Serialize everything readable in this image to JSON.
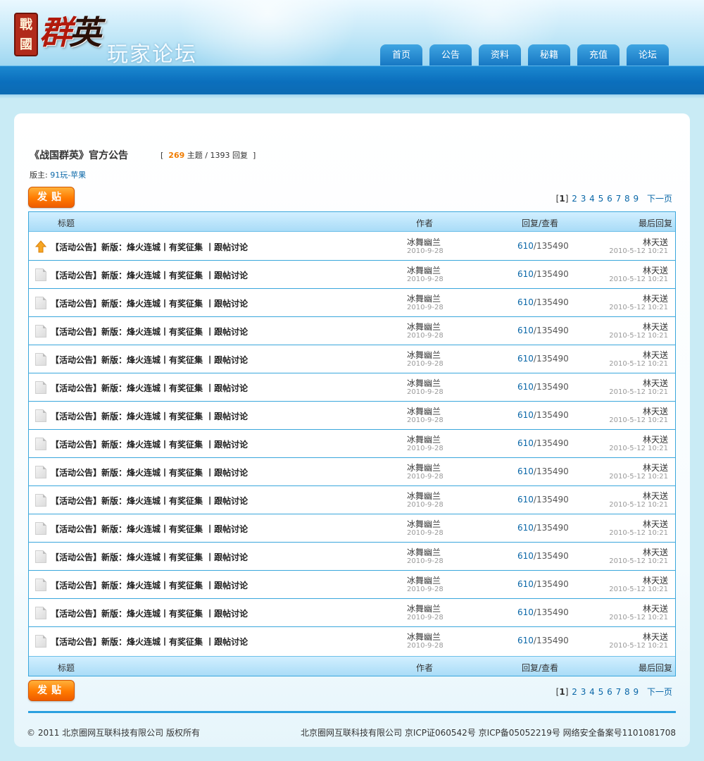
{
  "header": {
    "logo_seal": "戰國",
    "logo_main_1": "群",
    "logo_main_2": "英",
    "logo_sub": "玩家论坛",
    "nav": [
      "首页",
      "公告",
      "资料",
      "秘籍",
      "充值",
      "论坛"
    ]
  },
  "forum": {
    "title": "《战国群英》官方公告",
    "stats_open": "[",
    "topics": "269",
    "topics_label": "主题",
    "sep": "/",
    "replies": "1393",
    "replies_label": "回复",
    "stats_close": "]",
    "moderator_label": "版主:",
    "moderator_name": "91玩-苹果"
  },
  "post_button": "发贴",
  "pager": {
    "current": "1",
    "pages": [
      "2",
      "3",
      "4",
      "5",
      "6",
      "7",
      "8",
      "9"
    ],
    "next": "下一页"
  },
  "table": {
    "headers": {
      "title": "标题",
      "author": "作者",
      "counts": "回复/查看",
      "last": "最后回复"
    },
    "rows": [
      {
        "icon": "up-arrow-icon",
        "title": "【活动公告】新版：烽火连城丨有奖征集 丨跟帖讨论",
        "author": "冰舞幽兰",
        "author_date": "2010-9-28",
        "replies": "610",
        "views": "135490",
        "last_user": "林天送",
        "last_date": "2010-5-12 10:21"
      },
      {
        "icon": "doc-icon",
        "title": "【活动公告】新版：烽火连城丨有奖征集 丨跟帖讨论",
        "author": "冰舞幽兰",
        "author_date": "2010-9-28",
        "replies": "610",
        "views": "135490",
        "last_user": "林天送",
        "last_date": "2010-5-12 10:21"
      },
      {
        "icon": "doc-icon",
        "title": "【活动公告】新版：烽火连城丨有奖征集 丨跟帖讨论",
        "author": "冰舞幽兰",
        "author_date": "2010-9-28",
        "replies": "610",
        "views": "135490",
        "last_user": "林天送",
        "last_date": "2010-5-12 10:21"
      },
      {
        "icon": "doc-icon",
        "title": "【活动公告】新版：烽火连城丨有奖征集 丨跟帖讨论",
        "author": "冰舞幽兰",
        "author_date": "2010-9-28",
        "replies": "610",
        "views": "135490",
        "last_user": "林天送",
        "last_date": "2010-5-12 10:21"
      },
      {
        "icon": "doc-icon",
        "title": "【活动公告】新版：烽火连城丨有奖征集 丨跟帖讨论",
        "author": "冰舞幽兰",
        "author_date": "2010-9-28",
        "replies": "610",
        "views": "135490",
        "last_user": "林天送",
        "last_date": "2010-5-12 10:21"
      },
      {
        "icon": "doc-icon",
        "title": "【活动公告】新版：烽火连城丨有奖征集 丨跟帖讨论",
        "author": "冰舞幽兰",
        "author_date": "2010-9-28",
        "replies": "610",
        "views": "135490",
        "last_user": "林天送",
        "last_date": "2010-5-12 10:21"
      },
      {
        "icon": "doc-icon",
        "title": "【活动公告】新版：烽火连城丨有奖征集 丨跟帖讨论",
        "author": "冰舞幽兰",
        "author_date": "2010-9-28",
        "replies": "610",
        "views": "135490",
        "last_user": "林天送",
        "last_date": "2010-5-12 10:21"
      },
      {
        "icon": "doc-icon",
        "title": "【活动公告】新版：烽火连城丨有奖征集 丨跟帖讨论",
        "author": "冰舞幽兰",
        "author_date": "2010-9-28",
        "replies": "610",
        "views": "135490",
        "last_user": "林天送",
        "last_date": "2010-5-12 10:21"
      },
      {
        "icon": "doc-icon",
        "title": "【活动公告】新版：烽火连城丨有奖征集 丨跟帖讨论",
        "author": "冰舞幽兰",
        "author_date": "2010-9-28",
        "replies": "610",
        "views": "135490",
        "last_user": "林天送",
        "last_date": "2010-5-12 10:21"
      },
      {
        "icon": "doc-icon",
        "title": "【活动公告】新版：烽火连城丨有奖征集 丨跟帖讨论",
        "author": "冰舞幽兰",
        "author_date": "2010-9-28",
        "replies": "610",
        "views": "135490",
        "last_user": "林天送",
        "last_date": "2010-5-12 10:21"
      },
      {
        "icon": "doc-icon",
        "title": "【活动公告】新版：烽火连城丨有奖征集 丨跟帖讨论",
        "author": "冰舞幽兰",
        "author_date": "2010-9-28",
        "replies": "610",
        "views": "135490",
        "last_user": "林天送",
        "last_date": "2010-5-12 10:21"
      },
      {
        "icon": "doc-icon",
        "title": "【活动公告】新版：烽火连城丨有奖征集 丨跟帖讨论",
        "author": "冰舞幽兰",
        "author_date": "2010-9-28",
        "replies": "610",
        "views": "135490",
        "last_user": "林天送",
        "last_date": "2010-5-12 10:21"
      },
      {
        "icon": "doc-icon",
        "title": "【活动公告】新版：烽火连城丨有奖征集 丨跟帖讨论",
        "author": "冰舞幽兰",
        "author_date": "2010-9-28",
        "replies": "610",
        "views": "135490",
        "last_user": "林天送",
        "last_date": "2010-5-12 10:21"
      },
      {
        "icon": "doc-icon",
        "title": "【活动公告】新版：烽火连城丨有奖征集 丨跟帖讨论",
        "author": "冰舞幽兰",
        "author_date": "2010-9-28",
        "replies": "610",
        "views": "135490",
        "last_user": "林天送",
        "last_date": "2010-5-12 10:21"
      },
      {
        "icon": "doc-icon",
        "title": "【活动公告】新版：烽火连城丨有奖征集 丨跟帖讨论",
        "author": "冰舞幽兰",
        "author_date": "2010-9-28",
        "replies": "610",
        "views": "135490",
        "last_user": "林天送",
        "last_date": "2010-5-12 10:21"
      }
    ]
  },
  "footer": {
    "copyright": "© 2011 北京圈网互联科技有限公司 版权所有",
    "company_info": "北京圈网互联科技有限公司 京ICP证060542号 京ICP备05052219号 网络安全备案号1101081708"
  },
  "colors": {
    "accent_orange": "#ff7a00",
    "link_blue": "#0a67a8",
    "nav_blue": "#1778c4",
    "table_border": "#3aa7dc"
  }
}
